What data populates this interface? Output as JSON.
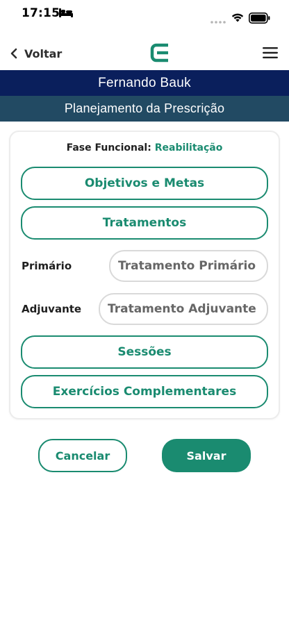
{
  "status_bar": {
    "time": "17:15",
    "icons": [
      "bed-icon",
      "dots-icon",
      "wifi-icon",
      "battery-icon"
    ]
  },
  "nav": {
    "back_label": "Voltar",
    "logo_icon": "logo-icon",
    "menu_icon": "hamburger-menu-icon"
  },
  "header": {
    "patient_name": "Fernando Bauk",
    "section_title": "Planejamento da Prescrição"
  },
  "form": {
    "phase_label": "Fase Funcional:",
    "phase_value": "Reabilitação",
    "objectives_button": "Objetivos e Metas",
    "treatments_button": "Tratamentos",
    "primary_label": "Primário",
    "primary_placeholder": "Tratamento Primário",
    "adjuvant_label": "Adjuvante",
    "adjuvant_placeholder": "Tratamento Adjuvante",
    "sessions_button": "Sessões",
    "exercises_button": "Exercícios Complementares"
  },
  "actions": {
    "cancel_label": "Cancelar",
    "save_label": "Salvar"
  },
  "colors": {
    "accent": "#1a8b70",
    "name_banner": "#0a1f5c",
    "section_banner": "#224a63"
  }
}
